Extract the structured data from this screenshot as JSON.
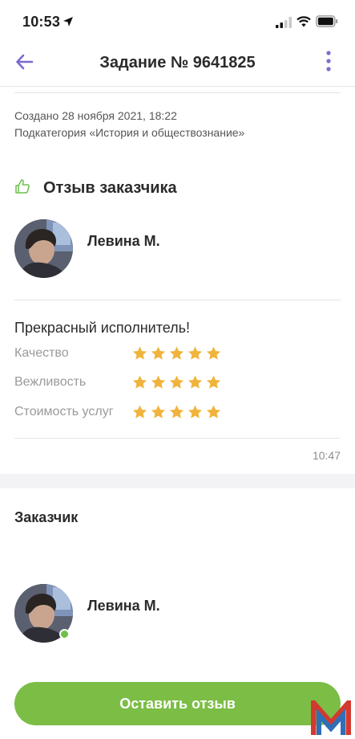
{
  "status_bar": {
    "time": "10:53"
  },
  "nav": {
    "title": "Задание № 9641825"
  },
  "meta": {
    "created": "Создано 28 ноября 2021, 18:22",
    "subcategory": "Подкатегория «История и обществознание»"
  },
  "review": {
    "heading": "Отзыв заказчика",
    "author": "Левина М.",
    "text": "Прекрасный исполнитель!",
    "ratings": [
      {
        "label": "Качество",
        "stars": 5
      },
      {
        "label": "Вежливость",
        "stars": 5
      },
      {
        "label": "Стоимость услуг",
        "stars": 5
      }
    ],
    "time": "10:47"
  },
  "customer": {
    "heading": "Заказчик",
    "name": "Левина М.",
    "online": true
  },
  "cta": {
    "label": "Оставить отзыв"
  },
  "colors": {
    "accent": "#7b6bd0",
    "green": "#7bbd45",
    "star": "#f0b43c"
  }
}
